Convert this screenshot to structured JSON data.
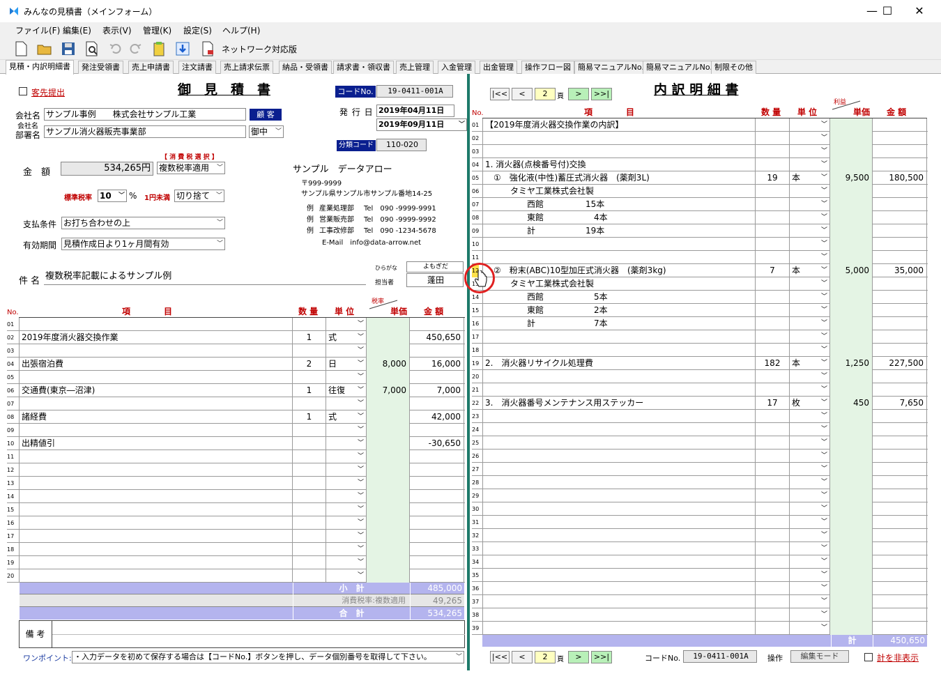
{
  "window": {
    "title": "みんなの見積書（メインフォーム）",
    "min": "—",
    "max": "☐",
    "close": "✕"
  },
  "menu": [
    "ファイル(F)",
    "編集(E)",
    "表示(V)",
    "管理(K)",
    "設定(S)",
    "ヘルプ(H)"
  ],
  "toolbar": {
    "network_label": "ネットワーク対応版"
  },
  "tabs": [
    "見積・内訳明細書",
    "発注受領書",
    "売上申請書",
    "注文請書",
    "売上請求伝票",
    "納品・受領書",
    "請求書・領収書",
    "売上管理",
    "入金管理",
    "出金管理",
    "操作フロー図",
    "簡易マニュアルNo.1",
    "簡易マニュアルNo.2",
    "制限その他"
  ],
  "left": {
    "guest_checkbox": "客先提出",
    "title": "御　見　積　書",
    "code_button": "コードNo.",
    "code_value": "19-0411-001A",
    "issue_label": "発 行 日",
    "issue_date": "2019年04月11日",
    "due_date": "2019年09月11日",
    "class_button": "分類コード",
    "class_value": "110-020",
    "company_label": "会社名",
    "company_value": "サンプル事例　　株式会社サンプル工業",
    "customer_button": "顧 客",
    "dept_label1": "会社名",
    "dept_label2": "部署名",
    "dept_value": "サンプル消火器販売事業部",
    "honorific": "御中",
    "tax_select_label": "【 消 費 税 選 択 】",
    "tax_select_value": "複数税率適用",
    "amount_label": "金　額",
    "amount_value": "534,265円",
    "rate_label": "標準税率",
    "rate_value": "10",
    "pct": "%",
    "round_label": "1円未満",
    "round_value": "切り捨て",
    "payment_label": "支払条件",
    "payment_value": "お打ち合わせの上",
    "valid_label": "有効期間",
    "valid_value": "見積作成日より1ヶ月間有効",
    "subject_label": "件 名",
    "subject_value": "複数税率記載によるサンプル例",
    "furigana_label": "ひらがな",
    "furigana_value": "よもぎだ",
    "person_label": "担当者",
    "person_value": "蓬田",
    "company_info": {
      "name": "サンプル　データアロー",
      "zip": "〒999-9999",
      "address": "サンプル県サンプル市サンプル番地14-25",
      "lines": [
        {
          "pre": "例",
          "dept": "産業処理部",
          "tel": "Tel　090 -9999-9991"
        },
        {
          "pre": "例",
          "dept": "営業販売部",
          "tel": "Tel　090 -9999-9992"
        },
        {
          "pre": "例",
          "dept": "工事改修部",
          "tel": "Tel　090 -1234-5678"
        }
      ],
      "email": "E-Mail　info@data-arrow.net"
    },
    "headers": {
      "no": "No.",
      "item": "項　　　　目",
      "qty": "数 量",
      "unit": "単 位",
      "rate": "税率",
      "price": "単価",
      "amount": "金 額"
    },
    "rows": [
      {
        "n": "01",
        "item": "",
        "qty": "",
        "unit": "",
        "price": "",
        "amount": ""
      },
      {
        "n": "02",
        "item": "2019年度消火器交換作業",
        "qty": "1",
        "unit": "式",
        "price": "",
        "amount": "450,650"
      },
      {
        "n": "03",
        "item": "",
        "qty": "",
        "unit": "",
        "price": "",
        "amount": ""
      },
      {
        "n": "04",
        "item": "出張宿泊費",
        "qty": "2",
        "unit": "日",
        "price": "8,000",
        "amount": "16,000"
      },
      {
        "n": "05",
        "item": "",
        "qty": "",
        "unit": "",
        "price": "",
        "amount": ""
      },
      {
        "n": "06",
        "item": "交通費(東京―沼津)",
        "qty": "1",
        "unit": "往復",
        "price": "7,000",
        "amount": "7,000"
      },
      {
        "n": "07",
        "item": "",
        "qty": "",
        "unit": "",
        "price": "",
        "amount": ""
      },
      {
        "n": "08",
        "item": "諸経費",
        "qty": "1",
        "unit": "式",
        "price": "",
        "amount": "42,000"
      },
      {
        "n": "09",
        "item": "",
        "qty": "",
        "unit": "",
        "price": "",
        "amount": ""
      },
      {
        "n": "10",
        "item": "出精値引",
        "qty": "",
        "unit": "",
        "price": "",
        "amount": "-30,650"
      },
      {
        "n": "11",
        "item": "",
        "qty": "",
        "unit": "",
        "price": "",
        "amount": ""
      },
      {
        "n": "12",
        "item": "",
        "qty": "",
        "unit": "",
        "price": "",
        "amount": ""
      },
      {
        "n": "13",
        "item": "",
        "qty": "",
        "unit": "",
        "price": "",
        "amount": ""
      },
      {
        "n": "14",
        "item": "",
        "qty": "",
        "unit": "",
        "price": "",
        "amount": ""
      },
      {
        "n": "15",
        "item": "",
        "qty": "",
        "unit": "",
        "price": "",
        "amount": ""
      },
      {
        "n": "16",
        "item": "",
        "qty": "",
        "unit": "",
        "price": "",
        "amount": ""
      },
      {
        "n": "17",
        "item": "",
        "qty": "",
        "unit": "",
        "price": "",
        "amount": ""
      },
      {
        "n": "18",
        "item": "",
        "qty": "",
        "unit": "",
        "price": "",
        "amount": ""
      },
      {
        "n": "19",
        "item": "",
        "qty": "",
        "unit": "",
        "price": "",
        "amount": ""
      },
      {
        "n": "20",
        "item": "",
        "qty": "",
        "unit": "",
        "price": "",
        "amount": ""
      }
    ],
    "subtotal_label": "小　計",
    "subtotal_value": "485,000",
    "tax_label": "消費税率:複数適用",
    "tax_value": "49,265",
    "total_label": "合　計",
    "total_value": "534,265",
    "remarks_label": "備 考",
    "tip_label": "ワンポイント:",
    "tip_value": "・入力データを初めて保存する場合は【コードNo.】ボタンを押し、データ個別番号を取得して下さい。"
  },
  "right": {
    "nav": {
      "first": "|<<",
      "prev": "<",
      "page": "2",
      "page_suffix": "頁",
      "next": ">",
      "last": ">>|"
    },
    "title": "内 訳 明 細 書",
    "headers": {
      "no": "No.",
      "item": "項　　　　目",
      "qty": "数 量",
      "unit": "単 位",
      "profit": "利益",
      "price": "単価",
      "amount": "金 額"
    },
    "rows": [
      {
        "n": "01",
        "item": "【2019年度消火器交換作業の内訳】",
        "qty": "",
        "unit": "",
        "price": "",
        "amount": ""
      },
      {
        "n": "02",
        "item": "",
        "qty": "",
        "unit": "",
        "price": "",
        "amount": ""
      },
      {
        "n": "03",
        "item": "",
        "qty": "",
        "unit": "",
        "price": "",
        "amount": ""
      },
      {
        "n": "04",
        "item": "1. 消火器(点検番号付)交換",
        "qty": "",
        "unit": "",
        "price": "",
        "amount": ""
      },
      {
        "n": "05",
        "item": "　①　強化液(中性)蓄圧式消火器　(薬剤3L)",
        "qty": "19",
        "unit": "本",
        "price": "9,500",
        "amount": "180,500"
      },
      {
        "n": "06",
        "item": "　　　タミヤ工業株式会社製",
        "qty": "",
        "unit": "",
        "price": "",
        "amount": ""
      },
      {
        "n": "07",
        "item": "　　　　　西館　　　　　15本",
        "qty": "",
        "unit": "",
        "price": "",
        "amount": ""
      },
      {
        "n": "08",
        "item": "　　　　　東館　　　　　　4本",
        "qty": "",
        "unit": "",
        "price": "",
        "amount": ""
      },
      {
        "n": "09",
        "item": "　　　　　計　　　　　　19本",
        "qty": "",
        "unit": "",
        "price": "",
        "amount": ""
      },
      {
        "n": "10",
        "item": "",
        "qty": "",
        "unit": "",
        "price": "",
        "amount": ""
      },
      {
        "n": "11",
        "item": "",
        "qty": "",
        "unit": "",
        "price": "",
        "amount": ""
      },
      {
        "n": "12",
        "item": "　②　粉末(ABC)10型加圧式消火器　(薬剤3kg)",
        "qty": "7",
        "unit": "本",
        "price": "5,000",
        "amount": "35,000"
      },
      {
        "n": "13",
        "item": "　　　タミヤ工業株式会社製",
        "qty": "",
        "unit": "",
        "price": "",
        "amount": ""
      },
      {
        "n": "14",
        "item": "　　　　　西館　　　　　　5本",
        "qty": "",
        "unit": "",
        "price": "",
        "amount": ""
      },
      {
        "n": "15",
        "item": "　　　　　東館　　　　　　2本",
        "qty": "",
        "unit": "",
        "price": "",
        "amount": ""
      },
      {
        "n": "16",
        "item": "　　　　　計　　　　　　　7本",
        "qty": "",
        "unit": "",
        "price": "",
        "amount": ""
      },
      {
        "n": "17",
        "item": "",
        "qty": "",
        "unit": "",
        "price": "",
        "amount": ""
      },
      {
        "n": "18",
        "item": "",
        "qty": "",
        "unit": "",
        "price": "",
        "amount": ""
      },
      {
        "n": "19",
        "item": "2.　消火器リサイクル処理費",
        "qty": "182",
        "unit": "本",
        "price": "1,250",
        "amount": "227,500"
      },
      {
        "n": "20",
        "item": "",
        "qty": "",
        "unit": "",
        "price": "",
        "amount": ""
      },
      {
        "n": "21",
        "item": "",
        "qty": "",
        "unit": "",
        "price": "",
        "amount": ""
      },
      {
        "n": "22",
        "item": "3.　消火器番号メンテナンス用ステッカー",
        "qty": "17",
        "unit": "枚",
        "price": "450",
        "amount": "7,650"
      },
      {
        "n": "23",
        "item": "",
        "qty": "",
        "unit": "",
        "price": "",
        "amount": ""
      },
      {
        "n": "24",
        "item": "",
        "qty": "",
        "unit": "",
        "price": "",
        "amount": ""
      },
      {
        "n": "25",
        "item": "",
        "qty": "",
        "unit": "",
        "price": "",
        "amount": ""
      },
      {
        "n": "26",
        "item": "",
        "qty": "",
        "unit": "",
        "price": "",
        "amount": ""
      },
      {
        "n": "27",
        "item": "",
        "qty": "",
        "unit": "",
        "price": "",
        "amount": ""
      },
      {
        "n": "28",
        "item": "",
        "qty": "",
        "unit": "",
        "price": "",
        "amount": ""
      },
      {
        "n": "29",
        "item": "",
        "qty": "",
        "unit": "",
        "price": "",
        "amount": ""
      },
      {
        "n": "30",
        "item": "",
        "qty": "",
        "unit": "",
        "price": "",
        "amount": ""
      },
      {
        "n": "31",
        "item": "",
        "qty": "",
        "unit": "",
        "price": "",
        "amount": ""
      },
      {
        "n": "32",
        "item": "",
        "qty": "",
        "unit": "",
        "price": "",
        "amount": ""
      },
      {
        "n": "33",
        "item": "",
        "qty": "",
        "unit": "",
        "price": "",
        "amount": ""
      },
      {
        "n": "34",
        "item": "",
        "qty": "",
        "unit": "",
        "price": "",
        "amount": ""
      },
      {
        "n": "35",
        "item": "",
        "qty": "",
        "unit": "",
        "price": "",
        "amount": ""
      },
      {
        "n": "36",
        "item": "",
        "qty": "",
        "unit": "",
        "price": "",
        "amount": ""
      },
      {
        "n": "37",
        "item": "",
        "qty": "",
        "unit": "",
        "price": "",
        "amount": ""
      },
      {
        "n": "38",
        "item": "",
        "qty": "",
        "unit": "",
        "price": "",
        "amount": ""
      },
      {
        "n": "39",
        "item": "",
        "qty": "",
        "unit": "",
        "price": "",
        "amount": ""
      }
    ],
    "total_label": "計",
    "total_value": "450,650",
    "code_label": "コードNo.",
    "code_value": "19-0411-001A",
    "op_label": "操作",
    "edit_mode": "編集モード",
    "hide_total": "計を非表示"
  },
  "colors": {
    "navy": "#0a1f8f",
    "grid": "#9a9a9a",
    "green": "#e4f4e4",
    "purple": "#b4b4ee",
    "divider": "#1e7a6a",
    "red": "#c00000"
  }
}
